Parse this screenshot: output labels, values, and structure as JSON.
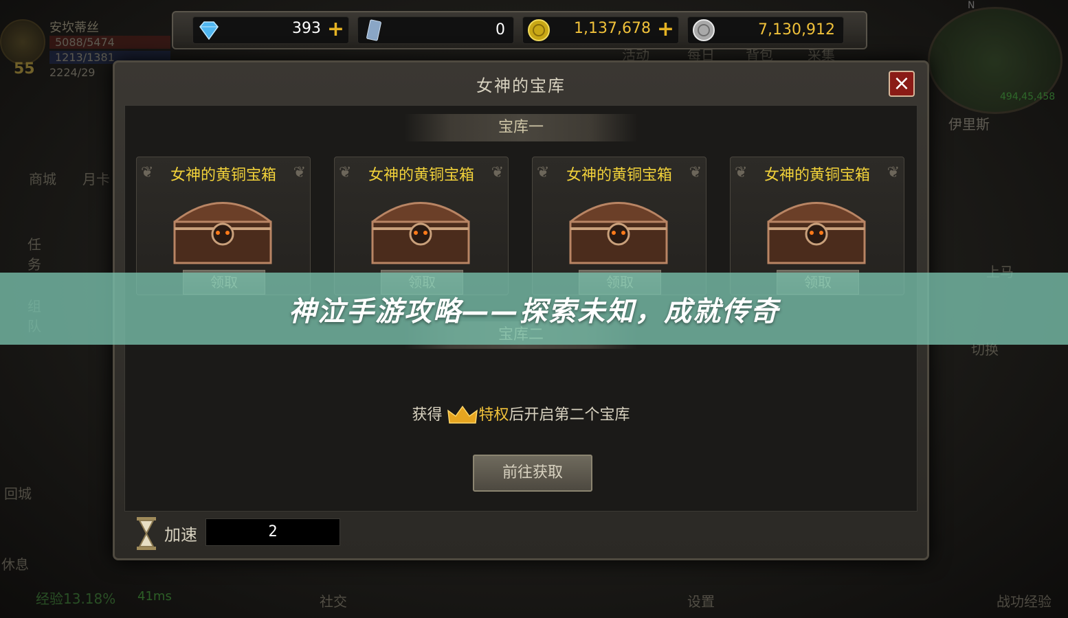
{
  "player": {
    "name": "安坎蒂丝",
    "level": "55",
    "hp": "5088/5474",
    "mp": "1213/1381",
    "exp": "2224/29"
  },
  "left_menu": [
    "商城",
    "月卡",
    "任务",
    "组队",
    "回城",
    "休息"
  ],
  "right_menu": [
    "活动",
    "每日",
    "背包",
    "采集",
    "上马",
    "切换"
  ],
  "minimap": {
    "compass": "N",
    "coords": "494,45,458",
    "map_name": "伊里斯"
  },
  "currency": {
    "diamond": "393",
    "voucher": "0",
    "gold": "1,137,678",
    "silver": "7,130,912"
  },
  "modal": {
    "title": "女神的宝库",
    "section1": "宝库一",
    "section2": "宝库二",
    "chests": [
      {
        "title": "女神的黄铜宝箱",
        "button": "领取"
      },
      {
        "title": "女神的黄铜宝箱",
        "button": "领取"
      },
      {
        "title": "女神的黄铜宝箱",
        "button": "领取"
      },
      {
        "title": "女神的黄铜宝箱",
        "button": "领取"
      }
    ],
    "unlock_prefix": "获得",
    "unlock_highlight": "特权",
    "unlock_suffix": "后开启第二个宝库",
    "goto_button": "前往获取",
    "speed_label": "加速",
    "speed_value": "2"
  },
  "bottom": {
    "exp": "经验13.18%",
    "ping": "41ms",
    "social": "社交",
    "settings": "设置",
    "battle_exp": "战功经验"
  },
  "banner": {
    "text": "神泣手游攻略——探索未知，成就传奇"
  },
  "colors": {
    "chest_title": "#f2d23a",
    "banner_bg": "#78beaa",
    "gold_plus": "#e5b324",
    "close_red": "#8a1b16"
  }
}
